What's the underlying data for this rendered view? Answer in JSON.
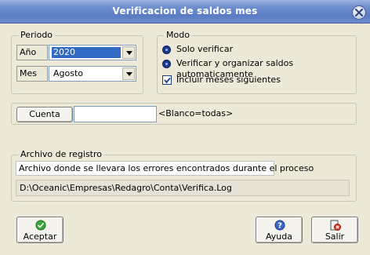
{
  "window": {
    "title": "Verificacion de saldos mes"
  },
  "periodo": {
    "legend": "Periodo",
    "ano_label": "Año",
    "ano_value": "2020",
    "mes_label": "Mes",
    "mes_value": "Agosto"
  },
  "modo": {
    "legend": "Modo",
    "option1": "Solo verificar",
    "option2": "Verificar y organizar saldos automaticamente",
    "check_label": "Incluir meses siguientes"
  },
  "cuenta": {
    "button_label": "Cuenta",
    "input_value": "",
    "hint": "<Blanco=todas>"
  },
  "archivo": {
    "legend": "Archivo de registro",
    "description": "Archivo donde se llevara los errores encontrados durante el proceso",
    "path": "D:\\Oceanic\\Empresas\\Redagro\\Conta\\Verifica.Log"
  },
  "buttons": {
    "aceptar": "Aceptar",
    "ayuda": "Ayuda",
    "salir": "Salir"
  },
  "colors": {
    "titlebar": "#6f8fce",
    "dialog_bg": "#ece9d8",
    "selection": "#316ac5"
  }
}
